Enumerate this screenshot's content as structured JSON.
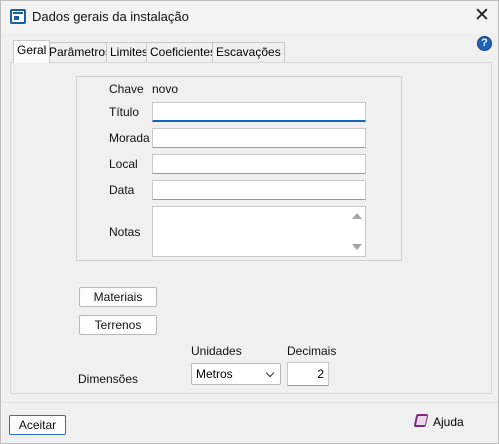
{
  "window": {
    "title": "Dados gerais da instalação",
    "close_glyph": "✕",
    "help_glyph": "?",
    "accent_color": "#1466b5"
  },
  "tabs": [
    {
      "label": "Geral",
      "active": true
    },
    {
      "label": "Parâmetros",
      "active": false
    },
    {
      "label": "Limites",
      "active": false
    },
    {
      "label": "Coeficientes",
      "active": false
    },
    {
      "label": "Escavações",
      "active": false
    }
  ],
  "general": {
    "chave_label": "Chave",
    "chave_value": "novo",
    "titulo_label": "Título",
    "titulo_value": "",
    "morada_label": "Morada",
    "morada_value": "",
    "local_label": "Local",
    "local_value": "",
    "data_label": "Data",
    "data_value": "",
    "notas_label": "Notas",
    "notas_value": ""
  },
  "buttons": {
    "materiais": "Materiais",
    "terrenos": "Terrenos",
    "aceitar": "Aceitar",
    "ajuda": "Ajuda"
  },
  "dimensions": {
    "label": "Dimensões",
    "units_header": "Unidades",
    "units_value": "Metros",
    "decimals_header": "Decimais",
    "decimals_value": "2"
  },
  "icons": {
    "app": "window-app-icon",
    "help_circle": "help-circle-icon",
    "help_book": "help-book-icon",
    "dropdown": "chevron-down-icon"
  }
}
